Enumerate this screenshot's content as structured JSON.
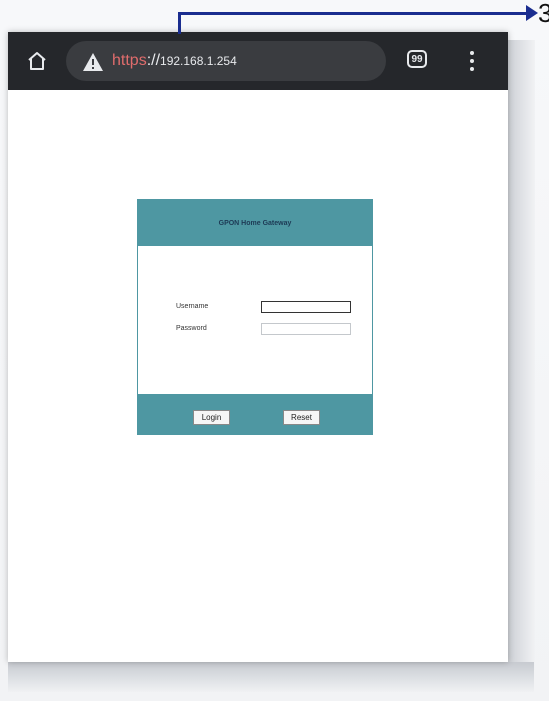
{
  "browser": {
    "url_scheme": "https",
    "url_separator": "://",
    "url_host": "192.168.1.254",
    "tab_count": "99",
    "icons": {
      "home": "home-icon",
      "warning": "warning-icon",
      "menu": "overflow-menu-icon"
    }
  },
  "login": {
    "title": "GPON Home Gateway",
    "username_label": "Username",
    "password_label": "Password",
    "username_value": "",
    "password_value": "",
    "login_label": "Login",
    "reset_label": "Reset"
  },
  "annotation": {
    "number": "3"
  },
  "colors": {
    "toolbar": "#25272b",
    "omnibox": "#3a3c40",
    "panel_accent": "#4e97a2",
    "annotation": "#1a2d8f",
    "url_scheme": "#e06c6c"
  }
}
